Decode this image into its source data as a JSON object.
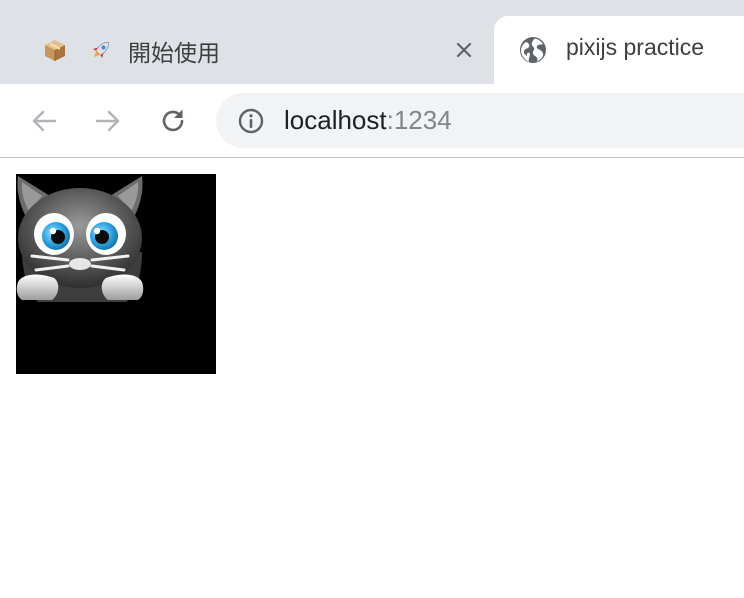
{
  "tabs": [
    {
      "favicons": [
        "box-icon",
        "rocket-icon"
      ],
      "title": "開始使用",
      "active": false
    },
    {
      "favicon": "globe-icon",
      "title": "pixijs practice",
      "active": true
    }
  ],
  "toolbar": {
    "back_icon": "arrow-left-icon",
    "forward_icon": "arrow-right-icon",
    "reload_icon": "reload-icon",
    "omnibox": {
      "info_icon": "info-icon",
      "host": "localhost",
      "port": ":1234"
    }
  },
  "content": {
    "canvas_background": "#000000",
    "sprite": "cat-sprite"
  },
  "colors": {
    "tabstrip": "#dee1e6",
    "omnibox": "#f1f3f4",
    "text": "#3c4043",
    "port_text": "#80868b",
    "disabled_icon": "#b0b3b8",
    "cat_eye": "#29a3e0"
  }
}
